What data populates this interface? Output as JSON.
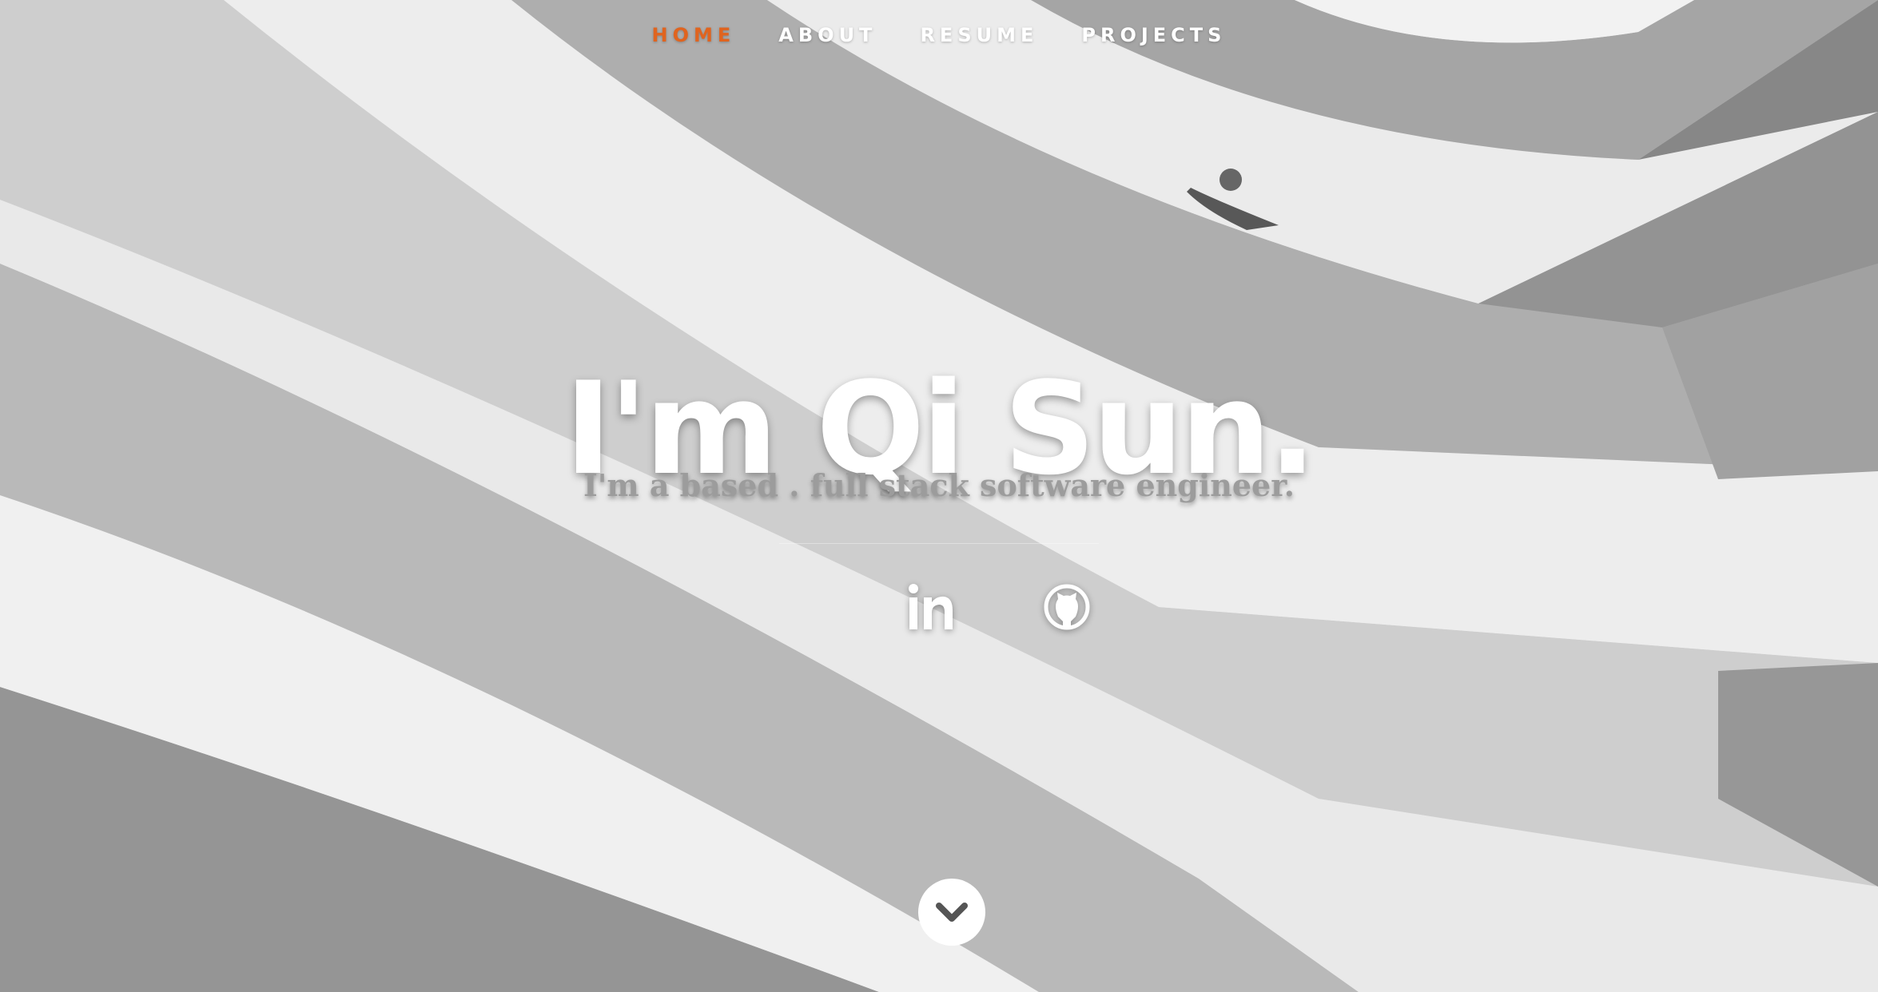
{
  "nav": {
    "items": [
      {
        "label": "HOME",
        "active": true
      },
      {
        "label": "ABOUT",
        "active": false
      },
      {
        "label": "RESUME",
        "active": false
      },
      {
        "label": "PROJECTS",
        "active": false
      }
    ]
  },
  "hero": {
    "headline": "I'm Qi Sun.",
    "subline": "I'm a based . full stack software engineer."
  },
  "social": [
    {
      "icon": "linkedin-icon"
    },
    {
      "icon": "github-icon"
    }
  ],
  "scroll": {
    "icon": "chevron-down-icon"
  },
  "colors": {
    "accent": "#e0641f",
    "nav_text": "#ffffff",
    "headline": "#ffffff",
    "subline": "#9c9c9c"
  }
}
